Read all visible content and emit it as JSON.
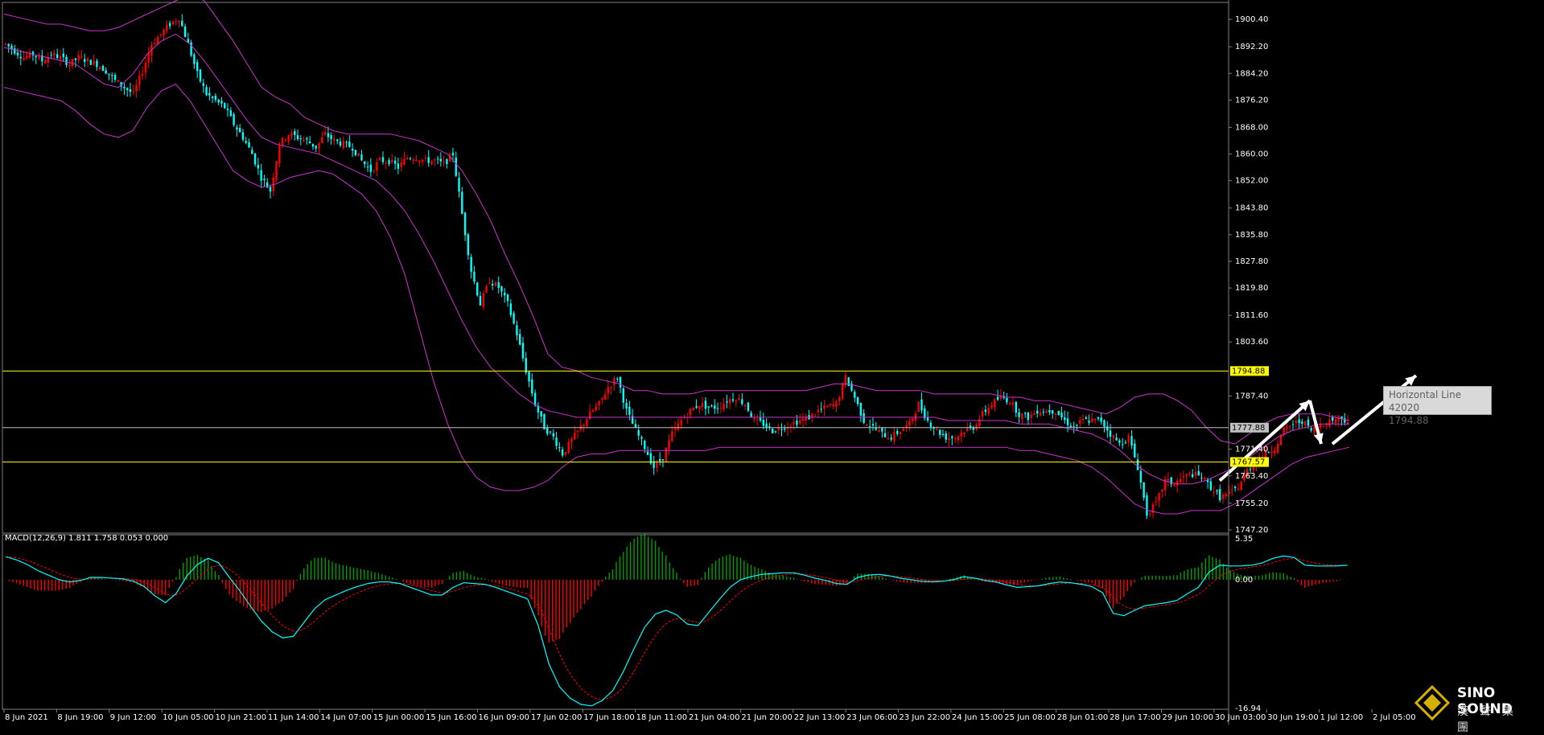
{
  "chart_data": {
    "type": "candlestick",
    "instrument_panel": {
      "y_ticks": [
        "1900.40",
        "1892.20",
        "1884.20",
        "1876.20",
        "1868.00",
        "1860.00",
        "1852.00",
        "1843.80",
        "1835.80",
        "1827.80",
        "1819.80",
        "1811.60",
        "1803.60",
        "1787.40",
        "1771.40",
        "1763.40",
        "1755.20",
        "1747.20"
      ],
      "y_tick_values": [
        1900.4,
        1892.2,
        1884.2,
        1876.2,
        1868.0,
        1860.0,
        1852.0,
        1843.8,
        1835.8,
        1827.8,
        1819.8,
        1811.6,
        1803.6,
        1787.4,
        1771.4,
        1763.4,
        1755.2,
        1747.2
      ],
      "ylim": [
        1746.7,
        1904.3
      ],
      "x_labels": [
        "8 Jun 2021",
        "8 Jun 19:00",
        "9 Jun 12:00",
        "10 Jun 05:00",
        "10 Jun 21:00",
        "11 Jun 14:00",
        "14 Jun 07:00",
        "15 Jun 00:00",
        "15 Jun 16:00",
        "16 Jun 09:00",
        "17 Jun 02:00",
        "17 Jun 18:00",
        "18 Jun 11:00",
        "21 Jun 04:00",
        "21 Jun 20:00",
        "22 Jun 13:00",
        "23 Jun 06:00",
        "23 Jun 22:00",
        "24 Jun 15:00",
        "25 Jun 08:00",
        "28 Jun 01:00",
        "28 Jun 17:00",
        "29 Jun 10:00",
        "30 Jun 03:00",
        "30 Jun 19:00",
        "1 Jul 12:00",
        "2 Jul 05:00"
      ],
      "price_path": [
        1893,
        1891,
        1889,
        1890,
        1888,
        1890,
        1889,
        1887,
        1889,
        1888,
        1887,
        1885,
        1882,
        1880,
        1878,
        1885,
        1893,
        1896,
        1899,
        1901,
        1893,
        1884,
        1878,
        1876,
        1874,
        1869,
        1865,
        1860,
        1853,
        1849,
        1863,
        1866,
        1865,
        1864,
        1862,
        1866,
        1864,
        1863,
        1862,
        1858,
        1855,
        1858,
        1858,
        1856,
        1859,
        1859,
        1858,
        1858,
        1857,
        1860,
        1842,
        1825,
        1815,
        1822,
        1820,
        1815,
        1806,
        1795,
        1785,
        1778,
        1775,
        1770,
        1774,
        1778,
        1782,
        1785,
        1790,
        1793,
        1783,
        1777,
        1772,
        1766,
        1769,
        1776,
        1780,
        1783,
        1785,
        1784,
        1784,
        1786,
        1787,
        1785,
        1780,
        1779,
        1777,
        1778,
        1779,
        1780,
        1781,
        1783,
        1784,
        1785,
        1793,
        1787,
        1780,
        1778,
        1776,
        1775,
        1777,
        1779,
        1785,
        1780,
        1777,
        1775,
        1775,
        1777,
        1778,
        1782,
        1785,
        1787,
        1786,
        1782,
        1781,
        1783,
        1783,
        1783,
        1780,
        1778,
        1780,
        1780,
        1780,
        1776,
        1773,
        1775,
        1766,
        1752,
        1755,
        1762,
        1761,
        1763,
        1764,
        1763,
        1760,
        1757,
        1758,
        1760,
        1765,
        1768,
        1770,
        1772,
        1777,
        1779,
        1780,
        1777,
        1779,
        1780,
        1781,
        1780
      ],
      "bollinger_upper": [
        1902,
        1901,
        1900,
        1899,
        1899,
        1898,
        1897,
        1897,
        1898,
        1900,
        1902,
        1904,
        1906,
        1908,
        1906,
        1900,
        1894,
        1887,
        1880,
        1877,
        1875,
        1871,
        1869,
        1867,
        1866,
        1866,
        1866,
        1866,
        1865,
        1864,
        1862,
        1860,
        1855,
        1848,
        1840,
        1830,
        1821,
        1811,
        1800,
        1796,
        1795,
        1793,
        1792,
        1791,
        1789,
        1789,
        1788,
        1788,
        1788,
        1789,
        1789,
        1789,
        1789,
        1789,
        1789,
        1789,
        1789,
        1790,
        1791,
        1791,
        1790,
        1789,
        1789,
        1789,
        1789,
        1788,
        1788,
        1788,
        1788,
        1788,
        1787,
        1787,
        1786,
        1786,
        1785,
        1784,
        1783,
        1782,
        1784,
        1787,
        1788,
        1788,
        1786,
        1783,
        1778,
        1774,
        1773,
        1776,
        1779,
        1781,
        1782,
        1782,
        1782,
        1781,
        1780
      ],
      "bollinger_middle": [
        1892,
        1891,
        1890,
        1889,
        1888,
        1887,
        1884,
        1881,
        1880,
        1884,
        1890,
        1894,
        1896,
        1893,
        1888,
        1882,
        1876,
        1870,
        1865,
        1863,
        1862,
        1861,
        1860,
        1858,
        1856,
        1854,
        1852,
        1848,
        1843,
        1836,
        1828,
        1819,
        1810,
        1802,
        1796,
        1792,
        1788,
        1785,
        1783,
        1782,
        1781,
        1781,
        1781,
        1781,
        1781,
        1781,
        1781,
        1781,
        1781,
        1781,
        1781,
        1781,
        1781,
        1781,
        1781,
        1781,
        1781,
        1781,
        1781,
        1781,
        1781,
        1781,
        1781,
        1781,
        1781,
        1781,
        1780,
        1780,
        1780,
        1780,
        1780,
        1779,
        1779,
        1779,
        1778,
        1777,
        1776,
        1774,
        1771,
        1767,
        1764,
        1762,
        1761,
        1761,
        1762,
        1764,
        1766,
        1769,
        1772,
        1775,
        1777,
        1778,
        1779,
        1779,
        1779
      ],
      "bollinger_lower": [
        1880,
        1879,
        1878,
        1877,
        1876,
        1873,
        1869,
        1866,
        1865,
        1867,
        1874,
        1879,
        1881,
        1876,
        1869,
        1862,
        1855,
        1852,
        1850,
        1851,
        1853,
        1854,
        1855,
        1854,
        1851,
        1848,
        1843,
        1835,
        1824,
        1808,
        1792,
        1779,
        1769,
        1763,
        1760,
        1759,
        1759,
        1760,
        1762,
        1766,
        1769,
        1770,
        1770,
        1771,
        1771,
        1771,
        1771,
        1771,
        1771,
        1771,
        1772,
        1772,
        1772,
        1772,
        1772,
        1772,
        1772,
        1772,
        1772,
        1772,
        1772,
        1772,
        1772,
        1772,
        1772,
        1772,
        1772,
        1772,
        1772,
        1772,
        1772,
        1771,
        1771,
        1770,
        1769,
        1768,
        1766,
        1763,
        1759,
        1755,
        1753,
        1752,
        1752,
        1753,
        1753,
        1753,
        1755,
        1758,
        1761,
        1764,
        1767,
        1769,
        1770,
        1771,
        1772
      ],
      "horizontal_lines": [
        {
          "value": 1794.88,
          "label": "1794.88",
          "color": "#ffff00"
        },
        {
          "value": 1777.88,
          "label": "1777.88",
          "color": "#c0c0c0"
        },
        {
          "value": 1767.57,
          "label": "1767.57",
          "color": "#ffff00"
        }
      ],
      "tooltip": {
        "line1": "Horizontal Line 42020",
        "line2": "1794.88"
      }
    },
    "macd_panel": {
      "title": "MACD(12,26,9) 1.811 1.758 0.053 0.000",
      "y_ticks": [
        "5.35",
        "0.00",
        "-16.94"
      ],
      "ylim": [
        -16.94,
        5.35
      ],
      "macd_path": [
        3.0,
        2.6,
        2.0,
        1.2,
        0.6,
        0.0,
        -0.3,
        -0.1,
        0.3,
        0.3,
        0.2,
        0.1,
        -0.2,
        -0.9,
        -2.1,
        -3.0,
        -1.8,
        0.5,
        2.0,
        2.8,
        2.2,
        0.3,
        -1.5,
        -3.5,
        -5.4,
        -6.8,
        -7.6,
        -7.4,
        -5.6,
        -3.8,
        -2.6,
        -2.0,
        -1.4,
        -0.9,
        -0.5,
        -0.3,
        -0.3,
        -0.5,
        -1.0,
        -1.5,
        -2.0,
        -2.0,
        -1.0,
        -0.4,
        -0.5,
        -0.6,
        -1.0,
        -1.5,
        -2.0,
        -2.5,
        -6.0,
        -11.0,
        -14.0,
        -15.5,
        -16.3,
        -16.5,
        -15.8,
        -14.5,
        -12.0,
        -9.0,
        -6.2,
        -4.5,
        -4.0,
        -4.6,
        -5.8,
        -6.0,
        -4.3,
        -2.6,
        -1.0,
        0.0,
        0.4,
        0.7,
        0.8,
        0.9,
        0.9,
        0.6,
        0.2,
        -0.1,
        -0.5,
        -0.6,
        0.3,
        0.6,
        0.7,
        0.5,
        0.2,
        0.0,
        -0.2,
        -0.3,
        -0.2,
        0.0,
        0.4,
        0.2,
        -0.1,
        -0.3,
        -0.7,
        -1.0,
        -0.9,
        -0.8,
        -0.5,
        -0.3,
        -0.4,
        -0.6,
        -0.9,
        -1.7,
        -4.4,
        -4.7,
        -4.0,
        -3.4,
        -3.2,
        -3.0,
        -2.7,
        -1.8,
        -1.0,
        1.0,
        1.9,
        1.8,
        1.8,
        1.9,
        2.2,
        2.8,
        3.1,
        2.9,
        1.9,
        1.8,
        1.8,
        1.8,
        1.9
      ]
    }
  },
  "branding": {
    "name": "SINO SOUND",
    "chinese": "漢聲集團"
  },
  "colors": {
    "background": "#000000",
    "bull": "#ff0000",
    "bear": "#00ffff",
    "bands": "#cc33cc",
    "hist_pos": "#00a000",
    "hist_neg": "#ff0000",
    "signal": "#ff0000",
    "macd": "#00ffff",
    "arrows": "#ffffff"
  }
}
